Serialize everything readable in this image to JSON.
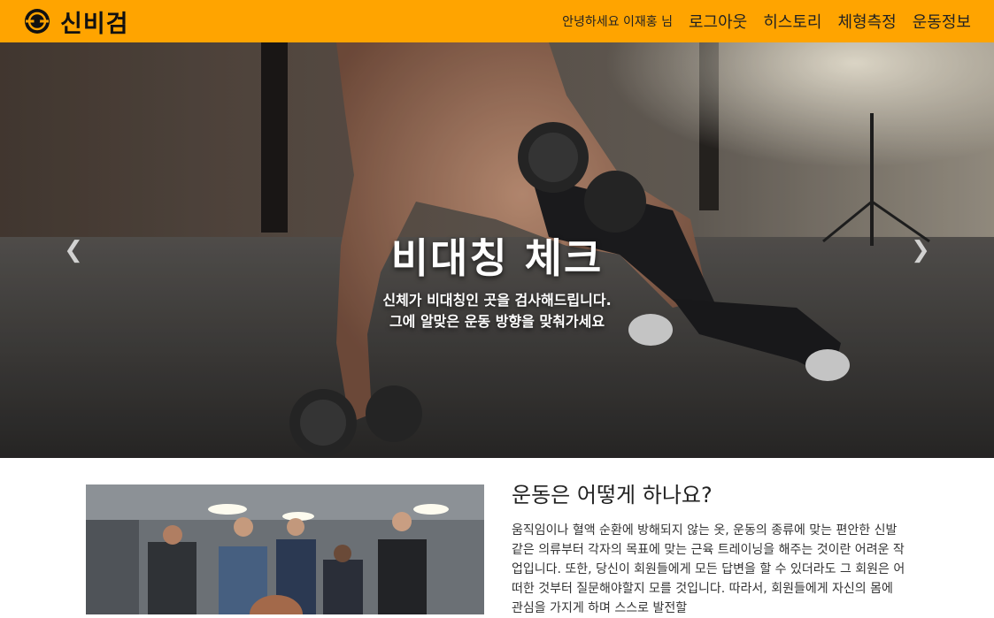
{
  "navbar": {
    "brand": "신비검",
    "logo_icon": "dumbbell-plate-icon",
    "greeting": "안녕하세요 이재홍 님",
    "links": [
      "로그아웃",
      "히스토리",
      "체형측정",
      "운동정보"
    ],
    "background": "#ffa400"
  },
  "hero": {
    "title": "비대칭 체크",
    "line1": "신체가 비대칭인 곳을 검사해드립니다.",
    "line2": "그에 알맞은 운동 방향을 맞춰가세요",
    "prev_icon": "chevron-left-icon",
    "next_icon": "chevron-right-icon"
  },
  "section": {
    "heading": "운동은 어떻게 하나요?",
    "body": "움직임이나 혈액 순환에 방해되지 않는 옷, 운동의 종류에 맞는 편안한 신발 같은 의류부터 각자의 목표에 맞는 근육 트레이닝을 해주는 것이란 어려운 작업입니다. 또한, 당신이 회원들에게 모든 답변을 할 수 있더라도 그 회원은 어떠한 것부터 질문해야할지 모를 것입니다. 따라서, 회원들에게 자신의 몸에 관심을 가지게 하며 스스로 발전할"
  }
}
